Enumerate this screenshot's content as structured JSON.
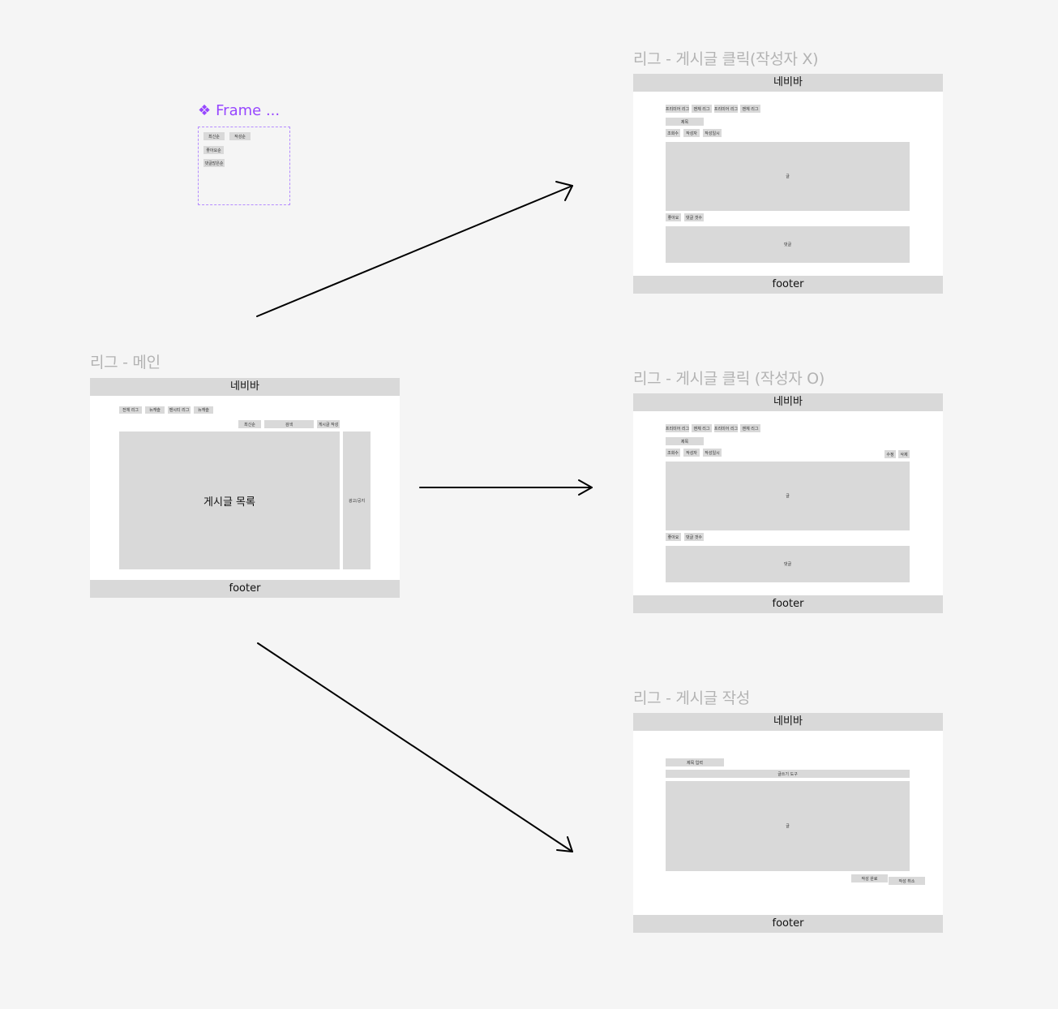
{
  "component": {
    "title": "Frame ...",
    "items": [
      "최신순",
      "좋아요순",
      "댓글많은순",
      "작성순"
    ]
  },
  "main": {
    "title": "리그 - 메인",
    "navbar": "네비바",
    "footer": "footer",
    "tabs": [
      "전체 리그",
      "뉴캐슬",
      "맨시티 리그",
      "뉴캐슬"
    ],
    "toolbar": [
      "최신순",
      "검색",
      "게시글 작성"
    ],
    "list_label": "게시글 목록",
    "side_label": "광고/공지"
  },
  "post_view_other": {
    "title": "리그 - 게시글 클릭(작성자 X)",
    "navbar": "네비바",
    "footer": "footer",
    "tags": [
      "프리미어 리그",
      "맨체 리그",
      "프리미어 리그",
      "맨체 리그"
    ],
    "post_title": "제목",
    "meta": [
      "조회수",
      "작성자",
      "작성일시"
    ],
    "body": "글",
    "actions": [
      "좋아요",
      "댓글 갯수"
    ],
    "comments": "댓글"
  },
  "post_view_owner": {
    "title": "리그 - 게시글 클릭 (작성자 O)",
    "navbar": "네비바",
    "footer": "footer",
    "tags": [
      "프리미어 리그",
      "맨체 리그",
      "프리미어 리그",
      "맨체 리그"
    ],
    "post_title": "제목",
    "meta": [
      "조회수",
      "작성자",
      "작성일시"
    ],
    "owner_actions": [
      "수정",
      "삭제"
    ],
    "body": "글",
    "actions": [
      "좋아요",
      "댓글 갯수"
    ],
    "comments": "댓글"
  },
  "post_write": {
    "title": "리그 - 게시글 작성",
    "navbar": "네비바",
    "footer": "footer",
    "title_input": "제목 입력",
    "editor_tools": "글쓰기 도구",
    "body": "글",
    "buttons": [
      "작성 완료",
      "작성 취소"
    ]
  },
  "colors": {
    "canvas": "#f5f5f5",
    "frame": "#ffffff",
    "placeholder": "#d9d9d9",
    "frame_title": "#b3b3b3",
    "component_accent": "#9747ff"
  }
}
